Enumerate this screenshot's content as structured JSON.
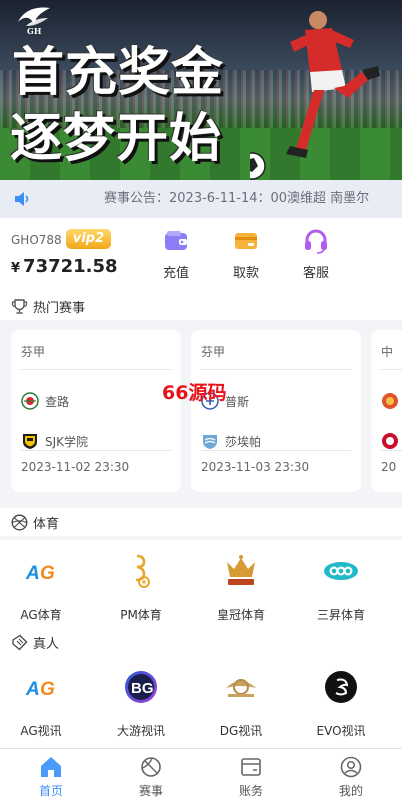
{
  "banner": {
    "logo_text": "GH",
    "title_line1": "首充奖金",
    "title_line2": "逐梦开始"
  },
  "notice": {
    "text": "赛事公告：2023-6-11-14：00澳维超 南墨尔"
  },
  "wallet": {
    "account": "GHO788",
    "vip_badge": "vip2",
    "currency_symbol": "¥",
    "balance": "73721.58",
    "actions": [
      {
        "label": "充值",
        "icon": "wallet-icon",
        "color": "#7b6cf6"
      },
      {
        "label": "取款",
        "icon": "card-icon",
        "color": "#f5a623"
      },
      {
        "label": "客服",
        "icon": "headset-icon",
        "color": "#b35cf0"
      }
    ]
  },
  "hot_matches": {
    "title": "热门赛事",
    "cards": [
      {
        "league": "芬甲",
        "home": "查路",
        "away": "SJK学院",
        "datetime": "2023-11-02 23:30"
      },
      {
        "league": "芬甲",
        "home": "普斯",
        "away": "莎埃帕",
        "datetime": "2023-11-03 23:30"
      },
      {
        "league": "中",
        "home": "",
        "away": "",
        "datetime": "20"
      }
    ]
  },
  "watermark": "66源码",
  "sports": {
    "title": "体育",
    "items": [
      {
        "label": "AG体育",
        "icon": "ag-logo-icon"
      },
      {
        "label": "PM体育",
        "icon": "pm-logo-icon"
      },
      {
        "label": "皇冠体育",
        "icon": "crown-logo-icon"
      },
      {
        "label": "三昇体育",
        "icon": "sansheng-logo-icon"
      }
    ]
  },
  "live": {
    "title": "真人",
    "items": [
      {
        "label": "AG视讯",
        "icon": "ag-logo-icon"
      },
      {
        "label": "大游视讯",
        "icon": "bg-logo-icon"
      },
      {
        "label": "DG视讯",
        "icon": "dg-logo-icon"
      },
      {
        "label": "EVO视讯",
        "icon": "evo-logo-icon"
      }
    ]
  },
  "nav": {
    "active_color": "#3d8ef7",
    "items": [
      {
        "label": "首页",
        "icon": "home-icon"
      },
      {
        "label": "赛事",
        "icon": "ball-icon"
      },
      {
        "label": "账务",
        "icon": "billing-icon"
      },
      {
        "label": "我的",
        "icon": "user-icon"
      }
    ]
  },
  "vip_logo_text": {
    "ag": "AG",
    "bg": "BG"
  }
}
